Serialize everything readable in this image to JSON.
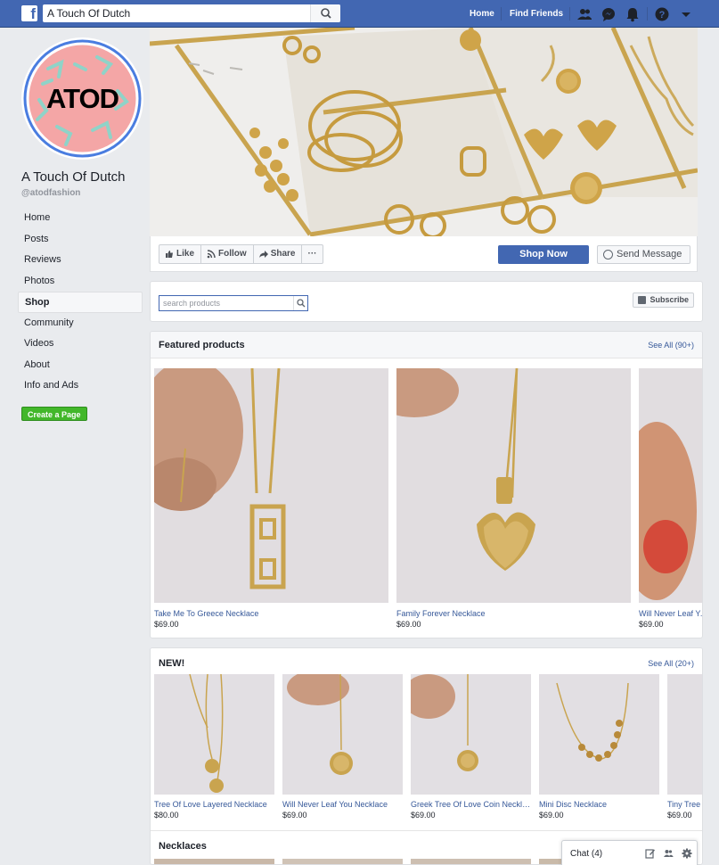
{
  "topbar": {
    "logo": "f",
    "search_value": "A Touch Of Dutch",
    "home": "Home",
    "find_friends": "Find Friends"
  },
  "page": {
    "logo_text": "ATOD",
    "name": "A Touch Of Dutch",
    "handle": "@atodfashion"
  },
  "sidebar": {
    "items": [
      {
        "label": "Home"
      },
      {
        "label": "Posts"
      },
      {
        "label": "Reviews"
      },
      {
        "label": "Photos"
      },
      {
        "label": "Shop"
      },
      {
        "label": "Community"
      },
      {
        "label": "Videos"
      },
      {
        "label": "About"
      },
      {
        "label": "Info and Ads"
      }
    ],
    "create_page": "Create a Page"
  },
  "actions": {
    "like": "Like",
    "follow": "Follow",
    "share": "Share",
    "more": "···",
    "shop_now": "Shop Now",
    "send_message": "Send Message"
  },
  "shop": {
    "search_placeholder": "search products",
    "subscribe": "Subscribe"
  },
  "featured": {
    "title": "Featured products",
    "see_all": "See All (90+)",
    "items": [
      {
        "name": "Take Me To Greece Necklace",
        "price": "$69.00"
      },
      {
        "name": "Family Forever Necklace",
        "price": "$69.00"
      },
      {
        "name": "Will Never Leaf You Necklace",
        "price": "$69.00"
      }
    ]
  },
  "new_section": {
    "title": "NEW!",
    "see_all": "See All (20+)",
    "items": [
      {
        "name": "Tree Of Love Layered Necklace",
        "price": "$80.00"
      },
      {
        "name": "Will Never Leaf You Necklace",
        "price": "$69.00"
      },
      {
        "name": "Greek Tree Of Love Coin Necklace",
        "price": "$69.00"
      },
      {
        "name": "Mini Disc Necklace",
        "price": "$69.00"
      },
      {
        "name": "Tiny Tree",
        "price": "$69.00"
      }
    ]
  },
  "necklaces": {
    "title": "Necklaces"
  },
  "chat": {
    "label": "Chat (4)"
  },
  "colors": {
    "brand": "#4267b2",
    "link": "#365899",
    "green": "#42b72a",
    "logo_pink": "#f4a6a6",
    "logo_mint": "#8fd3c8"
  }
}
